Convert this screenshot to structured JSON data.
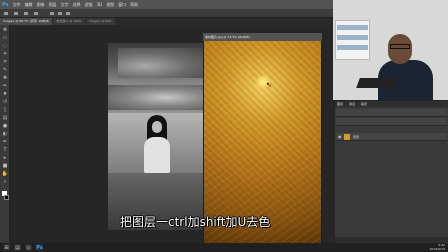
{
  "app": {
    "logo": "Ps",
    "menu": [
      "文件",
      "编辑",
      "图像",
      "图层",
      "文字",
      "选择",
      "滤镜",
      "3D",
      "视图",
      "窗口",
      "帮助"
    ]
  },
  "tabs": [
    {
      "label": "Image1 @ 66.7% (背景, RGB/8)"
    },
    {
      "label": "未标题-1 @ 100%"
    },
    {
      "label": "Image2 @ 50%"
    }
  ],
  "document": {
    "title": "素材图片.jpg @ 33.3% (RGB/8)"
  },
  "subtitle": "把图层一ctrl加shift加U去色",
  "layers_panel": {
    "tabs": [
      "图层",
      "通道",
      "路径"
    ],
    "layer": {
      "name": "背景"
    }
  },
  "taskbar": {
    "time": "9:42",
    "date": "2019/4/19"
  },
  "icons": {
    "visibility": "eye-icon",
    "cursor": "arrow-cursor-icon"
  },
  "colors": {
    "ps_blue": "#31a8ff",
    "texture_gold": "#d29b2a"
  }
}
